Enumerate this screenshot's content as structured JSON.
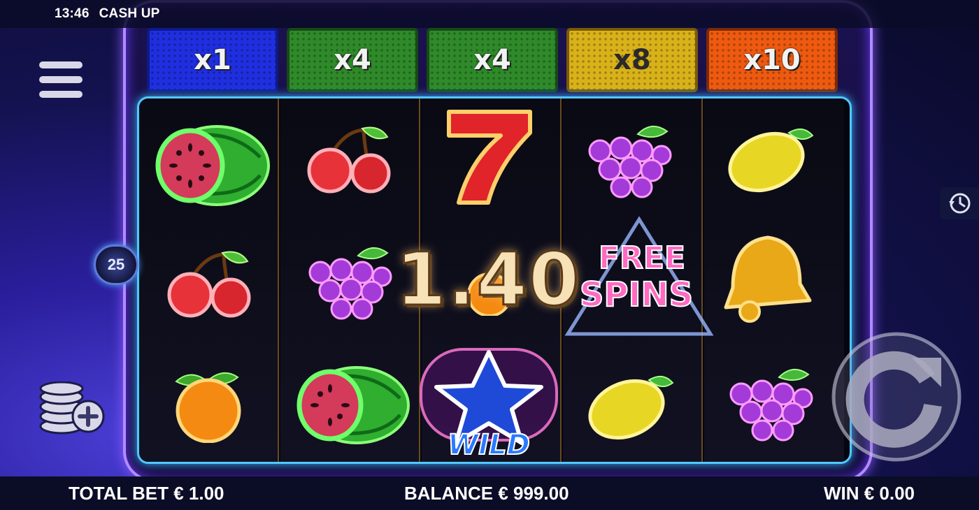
{
  "status_bar": {
    "time": "13:46",
    "game_title": "CASH UP"
  },
  "multipliers": [
    {
      "label": "x1",
      "color": "#1f2fe0"
    },
    {
      "label": "x4",
      "color": "#2f8a2a"
    },
    {
      "label": "x4",
      "color": "#2f8a2a"
    },
    {
      "label": "x8",
      "color": "#d9b21a"
    },
    {
      "label": "x10",
      "color": "#ee5a10"
    }
  ],
  "reels": [
    [
      "watermelon-icon",
      "cherry-icon",
      "orange-icon"
    ],
    [
      "cherry-icon",
      "grapes-icon",
      "watermelon-icon"
    ],
    [
      "seven-icon",
      "orange-icon",
      "wild-star-icon"
    ],
    [
      "grapes-icon",
      "free-spins-icon",
      "lemon-icon"
    ],
    [
      "lemon-icon",
      "bell-icon",
      "grapes-icon"
    ]
  ],
  "symbols_text": {
    "free_spins_line1": "FREE",
    "free_spins_line2": "SPINS",
    "wild": "WILD",
    "seven": "7"
  },
  "win_display": "1.40",
  "lines_badge": "25",
  "footer": {
    "total_bet": "TOTAL BET € 1.00",
    "balance": "BALANCE € 999.00",
    "win": "WIN € 0.00"
  },
  "colors": {
    "frame_purple": "#b48bff",
    "reels_border": "#52c8ff",
    "background": "#2a1e9c"
  }
}
